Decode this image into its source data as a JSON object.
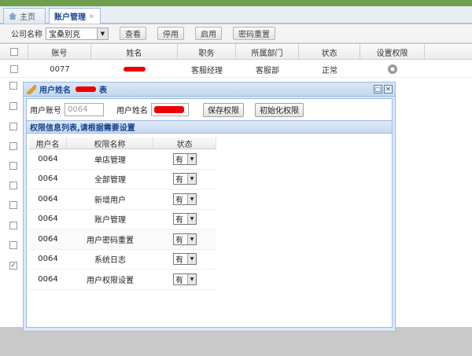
{
  "tabs": [
    {
      "label": "主页"
    },
    {
      "label": "账户管理",
      "close": "×"
    }
  ],
  "toolbar": {
    "company_label": "公司名称",
    "company_value": "宝桑别克",
    "buttons": [
      "查看",
      "停用",
      "启用",
      "密码重置"
    ]
  },
  "grid": {
    "columns": [
      "账号",
      "姓名",
      "职务",
      "所属部门",
      "状态",
      "设置权限"
    ],
    "rows": [
      {
        "account": "0077",
        "role": "客服经理",
        "dept": "客服部",
        "status": "正常"
      }
    ]
  },
  "dialog": {
    "title": "用户姓名",
    "title_suffix": "表",
    "account_label": "用户账号",
    "account_value": "0064",
    "name_label": "用户姓名",
    "save_btn": "保存权限",
    "init_btn": "初始化权限",
    "section_title": "权限信息列表,请根据需要设置",
    "table_headers": [
      "用户名",
      "权限名称",
      "状态"
    ],
    "permissions": [
      {
        "user": "0064",
        "name": "单店管理",
        "status": "有"
      },
      {
        "user": "0064",
        "name": "全部管理",
        "status": "有"
      },
      {
        "user": "0064",
        "name": "新增用户",
        "status": "有"
      },
      {
        "user": "0064",
        "name": "账户管理",
        "status": "有"
      },
      {
        "user": "0064",
        "name": "用户密码重置",
        "status": "有"
      },
      {
        "user": "0064",
        "name": "系统日志",
        "status": "有"
      },
      {
        "user": "0064",
        "name": "用户权限设置",
        "status": "有"
      }
    ]
  },
  "colors": {
    "accent": "#15428b",
    "border": "#99bbe8",
    "redaction": "#e00000"
  }
}
